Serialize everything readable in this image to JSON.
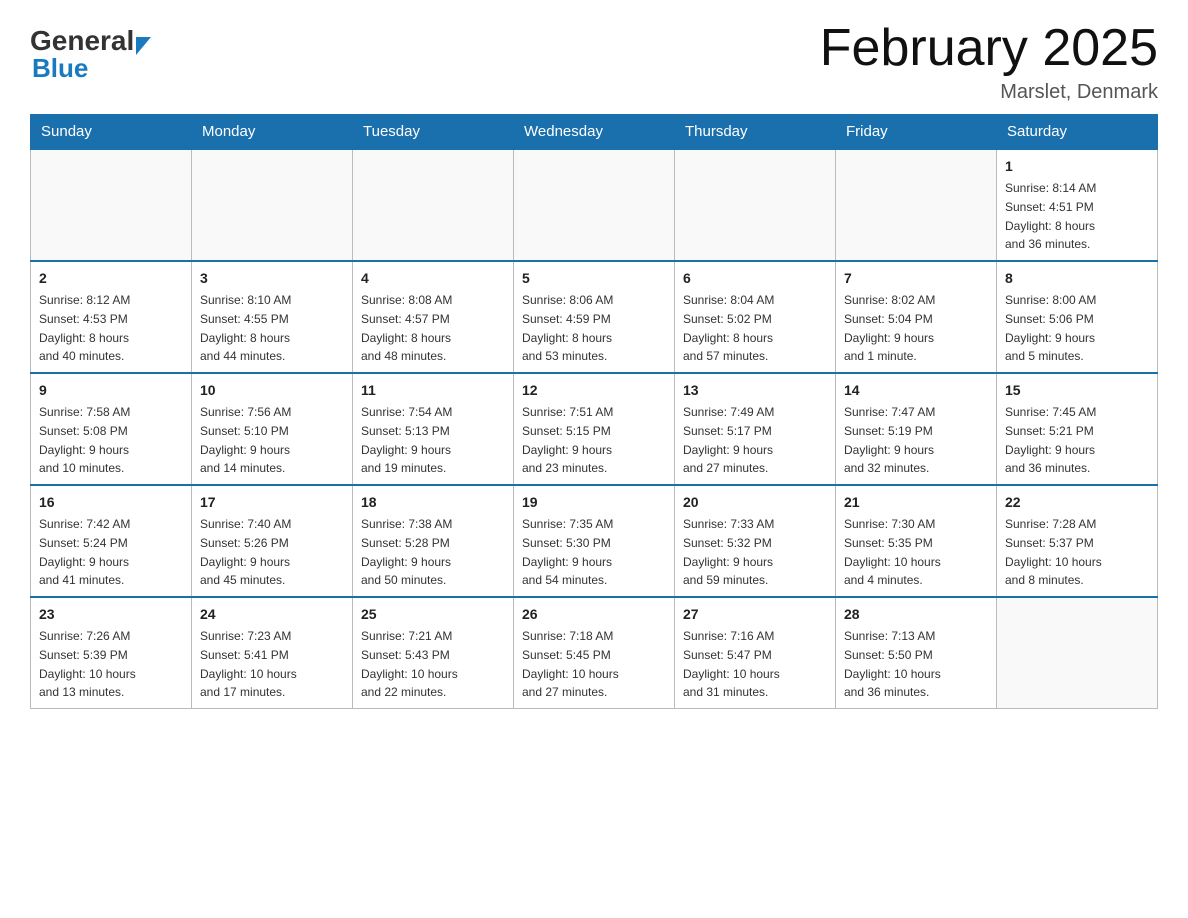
{
  "header": {
    "logo_general": "General",
    "logo_blue": "Blue",
    "title": "February 2025",
    "location": "Marslet, Denmark"
  },
  "days_of_week": [
    "Sunday",
    "Monday",
    "Tuesday",
    "Wednesday",
    "Thursday",
    "Friday",
    "Saturday"
  ],
  "weeks": [
    {
      "days": [
        {
          "num": "",
          "info": ""
        },
        {
          "num": "",
          "info": ""
        },
        {
          "num": "",
          "info": ""
        },
        {
          "num": "",
          "info": ""
        },
        {
          "num": "",
          "info": ""
        },
        {
          "num": "",
          "info": ""
        },
        {
          "num": "1",
          "info": "Sunrise: 8:14 AM\nSunset: 4:51 PM\nDaylight: 8 hours\nand 36 minutes."
        }
      ]
    },
    {
      "days": [
        {
          "num": "2",
          "info": "Sunrise: 8:12 AM\nSunset: 4:53 PM\nDaylight: 8 hours\nand 40 minutes."
        },
        {
          "num": "3",
          "info": "Sunrise: 8:10 AM\nSunset: 4:55 PM\nDaylight: 8 hours\nand 44 minutes."
        },
        {
          "num": "4",
          "info": "Sunrise: 8:08 AM\nSunset: 4:57 PM\nDaylight: 8 hours\nand 48 minutes."
        },
        {
          "num": "5",
          "info": "Sunrise: 8:06 AM\nSunset: 4:59 PM\nDaylight: 8 hours\nand 53 minutes."
        },
        {
          "num": "6",
          "info": "Sunrise: 8:04 AM\nSunset: 5:02 PM\nDaylight: 8 hours\nand 57 minutes."
        },
        {
          "num": "7",
          "info": "Sunrise: 8:02 AM\nSunset: 5:04 PM\nDaylight: 9 hours\nand 1 minute."
        },
        {
          "num": "8",
          "info": "Sunrise: 8:00 AM\nSunset: 5:06 PM\nDaylight: 9 hours\nand 5 minutes."
        }
      ]
    },
    {
      "days": [
        {
          "num": "9",
          "info": "Sunrise: 7:58 AM\nSunset: 5:08 PM\nDaylight: 9 hours\nand 10 minutes."
        },
        {
          "num": "10",
          "info": "Sunrise: 7:56 AM\nSunset: 5:10 PM\nDaylight: 9 hours\nand 14 minutes."
        },
        {
          "num": "11",
          "info": "Sunrise: 7:54 AM\nSunset: 5:13 PM\nDaylight: 9 hours\nand 19 minutes."
        },
        {
          "num": "12",
          "info": "Sunrise: 7:51 AM\nSunset: 5:15 PM\nDaylight: 9 hours\nand 23 minutes."
        },
        {
          "num": "13",
          "info": "Sunrise: 7:49 AM\nSunset: 5:17 PM\nDaylight: 9 hours\nand 27 minutes."
        },
        {
          "num": "14",
          "info": "Sunrise: 7:47 AM\nSunset: 5:19 PM\nDaylight: 9 hours\nand 32 minutes."
        },
        {
          "num": "15",
          "info": "Sunrise: 7:45 AM\nSunset: 5:21 PM\nDaylight: 9 hours\nand 36 minutes."
        }
      ]
    },
    {
      "days": [
        {
          "num": "16",
          "info": "Sunrise: 7:42 AM\nSunset: 5:24 PM\nDaylight: 9 hours\nand 41 minutes."
        },
        {
          "num": "17",
          "info": "Sunrise: 7:40 AM\nSunset: 5:26 PM\nDaylight: 9 hours\nand 45 minutes."
        },
        {
          "num": "18",
          "info": "Sunrise: 7:38 AM\nSunset: 5:28 PM\nDaylight: 9 hours\nand 50 minutes."
        },
        {
          "num": "19",
          "info": "Sunrise: 7:35 AM\nSunset: 5:30 PM\nDaylight: 9 hours\nand 54 minutes."
        },
        {
          "num": "20",
          "info": "Sunrise: 7:33 AM\nSunset: 5:32 PM\nDaylight: 9 hours\nand 59 minutes."
        },
        {
          "num": "21",
          "info": "Sunrise: 7:30 AM\nSunset: 5:35 PM\nDaylight: 10 hours\nand 4 minutes."
        },
        {
          "num": "22",
          "info": "Sunrise: 7:28 AM\nSunset: 5:37 PM\nDaylight: 10 hours\nand 8 minutes."
        }
      ]
    },
    {
      "days": [
        {
          "num": "23",
          "info": "Sunrise: 7:26 AM\nSunset: 5:39 PM\nDaylight: 10 hours\nand 13 minutes."
        },
        {
          "num": "24",
          "info": "Sunrise: 7:23 AM\nSunset: 5:41 PM\nDaylight: 10 hours\nand 17 minutes."
        },
        {
          "num": "25",
          "info": "Sunrise: 7:21 AM\nSunset: 5:43 PM\nDaylight: 10 hours\nand 22 minutes."
        },
        {
          "num": "26",
          "info": "Sunrise: 7:18 AM\nSunset: 5:45 PM\nDaylight: 10 hours\nand 27 minutes."
        },
        {
          "num": "27",
          "info": "Sunrise: 7:16 AM\nSunset: 5:47 PM\nDaylight: 10 hours\nand 31 minutes."
        },
        {
          "num": "28",
          "info": "Sunrise: 7:13 AM\nSunset: 5:50 PM\nDaylight: 10 hours\nand 36 minutes."
        },
        {
          "num": "",
          "info": ""
        }
      ]
    }
  ]
}
